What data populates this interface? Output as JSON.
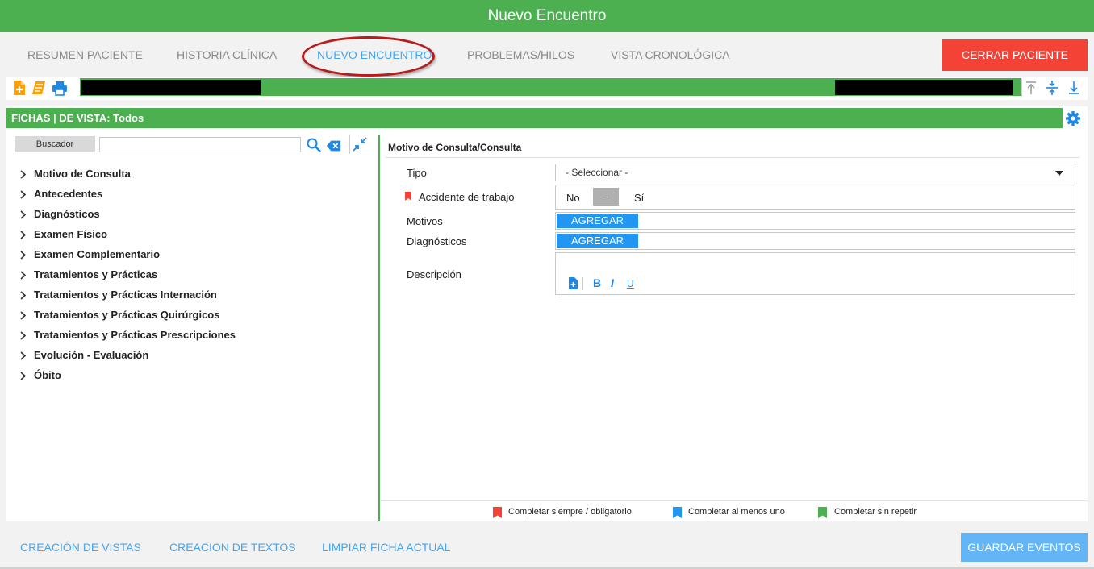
{
  "window": {
    "title": "Nuevo Encuentro"
  },
  "nav": {
    "tabs": [
      {
        "label": "RESUMEN PACIENTE"
      },
      {
        "label": "HISTORIA CLÍNICA"
      },
      {
        "label": "NUEVO ENCUENTRO",
        "active": true
      },
      {
        "label": "PROBLEMAS/HILOS"
      },
      {
        "label": "VISTA CRONOLÓGICA"
      }
    ],
    "close_patient": "CERRAR PACIENTE"
  },
  "patient_bar": {
    "icons": [
      "new-document-icon",
      "notes-icon",
      "print-icon",
      "collapse-top-icon",
      "collapse-middle-icon",
      "collapse-bottom-icon"
    ]
  },
  "fichas": {
    "header": "FICHAS | DE VISTA: Todos",
    "search_label": "Buscador",
    "search_value": "",
    "tree": [
      "Motivo de Consulta",
      "Antecedentes",
      "Diagnósticos",
      "Examen Físico",
      "Examen Complementario",
      "Tratamientos y Prácticas",
      "Tratamientos y Prácticas Internación",
      "Tratamientos y Prácticas Quirúrgicos",
      "Tratamientos y Prácticas Prescripciones",
      "Evolución - Evaluación",
      "Óbito"
    ]
  },
  "form": {
    "title": "Motivo de Consulta/Consulta",
    "tipo_label": "Tipo",
    "tipo_value": "- Seleccionar -",
    "accidente_label": "Accidente de trabajo",
    "accidente_no": "No",
    "accidente_mid": "-",
    "accidente_si": "Sí",
    "motivos_label": "Motivos",
    "motivos_button": "AGREGAR",
    "diagnosticos_label": "Diagnósticos",
    "diagnosticos_button": "AGREGAR",
    "descripcion_label": "Descripción",
    "rich_text": {
      "bold": "B",
      "italic": "I",
      "underline": "U"
    }
  },
  "legend": [
    {
      "label": "Completar siempre / obligatorio",
      "color": "#f44336"
    },
    {
      "label": "Completar al menos uno",
      "color": "#2196f3"
    },
    {
      "label": "Completar sin repetir",
      "color": "#4caf50"
    }
  ],
  "footer": {
    "links": [
      "CREACIÓN DE VISTAS",
      "CREACION DE TEXTOS",
      "LIMPIAR FICHA ACTUAL"
    ],
    "save": "GUARDAR EVENTOS"
  },
  "colors": {
    "primary_green": "#4caf50",
    "danger": "#f44336",
    "accent_blue": "#2196f3"
  }
}
